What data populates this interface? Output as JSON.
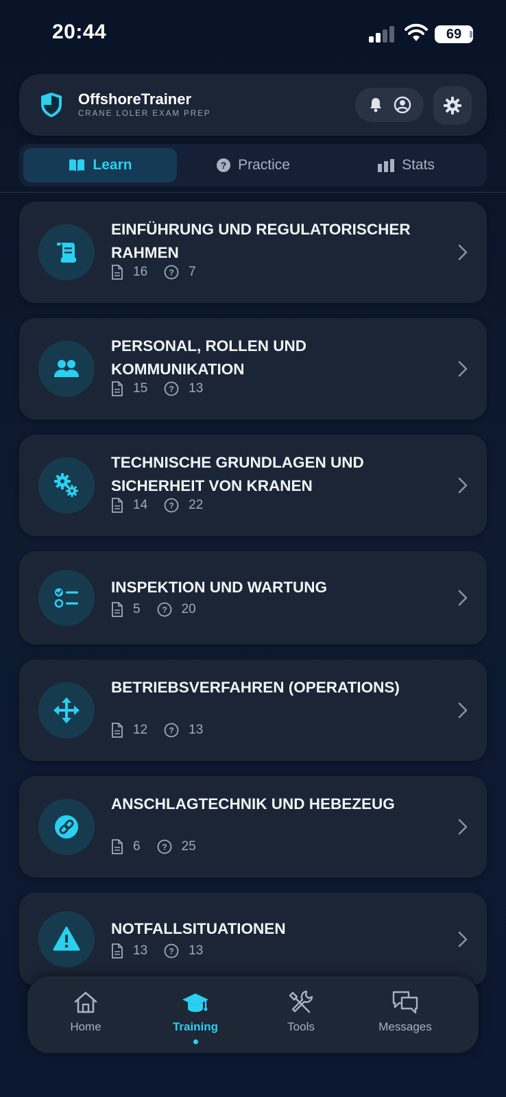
{
  "status_bar": {
    "time": "20:44",
    "battery": "69"
  },
  "header": {
    "title": "OffshoreTrainer",
    "subtitle": "CRANE LOLER EXAM PREP"
  },
  "tabs": [
    {
      "label": "Learn",
      "active": true
    },
    {
      "label": "Practice",
      "active": false
    },
    {
      "label": "Stats",
      "active": false
    }
  ],
  "modules": [
    {
      "title": "EINFÜHRUNG UND REGULATORISCHER RAHMEN",
      "docs": "16",
      "questions": "7",
      "icon": "scroll-icon"
    },
    {
      "title": "PERSONAL, ROLLEN UND KOMMUNIKATION",
      "docs": "15",
      "questions": "13",
      "icon": "users-icon"
    },
    {
      "title": "TECHNISCHE GRUNDLAGEN UND SICHERHEIT VON KRANEN",
      "docs": "14",
      "questions": "22",
      "icon": "gears-icon"
    },
    {
      "title": "INSPEKTION UND WARTUNG",
      "docs": "5",
      "questions": "20",
      "icon": "checklist-icon"
    },
    {
      "title": "BETRIEBSVERFAHREN (OPERATIONS)",
      "docs": "12",
      "questions": "13",
      "icon": "move-arrows-icon"
    },
    {
      "title": "ANSCHLAGTECHNIK UND HEBEZEUG",
      "docs": "6",
      "questions": "25",
      "icon": "link-icon"
    },
    {
      "title": "NOTFALLSITUATIONEN",
      "docs": "13",
      "questions": "13",
      "icon": "warning-icon"
    }
  ],
  "bottom_nav": [
    {
      "label": "Home",
      "icon": "home-icon",
      "active": false
    },
    {
      "label": "Training",
      "icon": "graduation-cap-icon",
      "active": true
    },
    {
      "label": "Tools",
      "icon": "tools-icon",
      "active": false
    },
    {
      "label": "Messages",
      "icon": "messages-icon",
      "active": false
    }
  ],
  "colors": {
    "accent": "#2ad0f0",
    "card": "#1c2535",
    "background": "#0a1428"
  }
}
